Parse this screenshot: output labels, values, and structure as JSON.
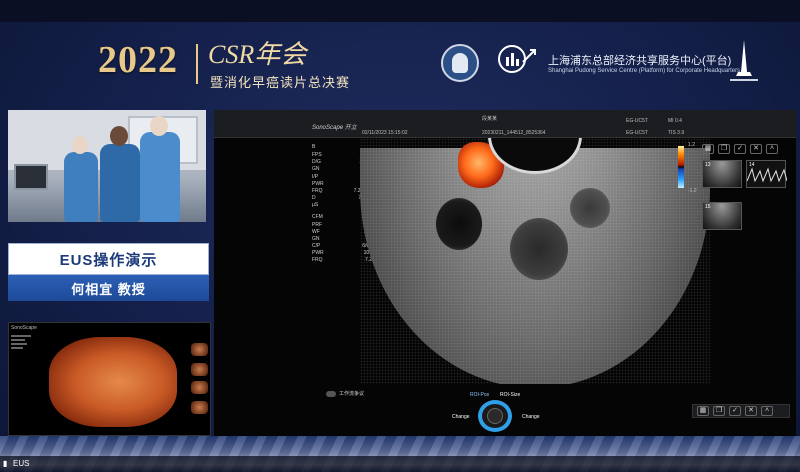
{
  "event": {
    "year": "2022",
    "title": "CSR年会",
    "subtitle": "暨消化早癌读片总决赛"
  },
  "org": {
    "cn": "上海浦东总部经济共享服务中心(平台)",
    "en": "Shanghai Pudong Service Centre (Platform) for Corporate Headquarters"
  },
  "demo": {
    "label": "EUS操作演示",
    "presenter": "何相宜 教授"
  },
  "endoscope": {
    "brand": "SonoScape"
  },
  "ultrasound": {
    "brand": "SonoScape 开立",
    "datetime": "02/11/2023 15:15:02",
    "patient": "段某某",
    "study_id": "20230211_144512_8525364",
    "probe_1": "EG-UC5T",
    "probe_2": "EG-UC5T",
    "mi": "MI 0.4",
    "tis": "TIS 3.9",
    "b_header": "B",
    "b_params": [
      {
        "k": "FPS",
        "v": "16"
      },
      {
        "k": "D/G",
        "v": "200/2"
      },
      {
        "k": "GN",
        "v": "175"
      },
      {
        "k": "I/P",
        "v": "0/10"
      },
      {
        "k": "PWR",
        "v": "60"
      },
      {
        "k": "FRQ",
        "v": "7.2-10.8"
      },
      {
        "k": "D",
        "v": "7.0cm"
      },
      {
        "k": "μS",
        "v": "2"
      }
    ],
    "cfm_header": "CFM",
    "cfm_params": [
      {
        "k": "PRF",
        "v": "1.2"
      },
      {
        "k": "WF",
        "v": "150"
      },
      {
        "k": "GN",
        "v": ""
      },
      {
        "k": "C/P",
        "v": "6/60"
      },
      {
        "k": "PWR",
        "v": "100"
      },
      {
        "k": "FRQ",
        "v": "7.2"
      }
    ],
    "scale_top": "1.2",
    "scale_bottom": "-1.2",
    "thumbnails": [
      {
        "num": "13"
      },
      {
        "num": "14"
      },
      {
        "num": "15"
      }
    ],
    "notice": "工作流争议",
    "roi_pos": "ROI-Pos",
    "roi_size": "ROI-Size",
    "change_left": "Change",
    "change_right": "Change"
  },
  "status": {
    "icon": "signal-icon",
    "label": "EUS"
  },
  "colors": {
    "accent_gold": "#e8c98a",
    "presenter_blue": "#1e4a98",
    "knob_ring": "#2fa0e8",
    "doppler": "#ff6a1a"
  }
}
